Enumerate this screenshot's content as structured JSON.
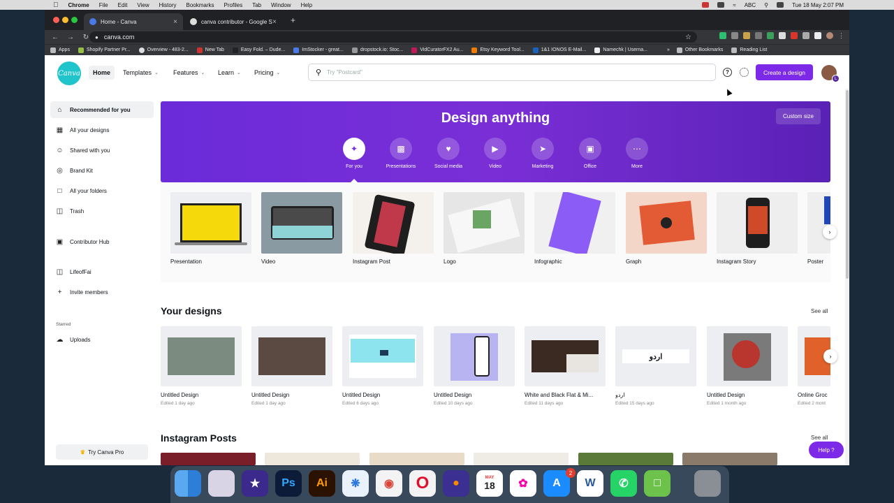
{
  "macbar": {
    "app": "Chrome",
    "menus": [
      "File",
      "Edit",
      "View",
      "History",
      "Bookmarks",
      "Profiles",
      "Tab",
      "Window",
      "Help"
    ],
    "input_source": "ABC",
    "clock": "Tue 18 May  2:07 PM"
  },
  "browser": {
    "tabs": [
      {
        "title": "Home - Canva",
        "active": true
      },
      {
        "title": "canva contributor - Google Se",
        "active": false
      }
    ],
    "url": "canva.com",
    "bookmarks": [
      "Apps",
      "Shopify Partner Pr...",
      "Overview - 483-2...",
      "New Tab",
      "Easy Fold. – Dude...",
      "ImStocker - great...",
      "dropstock.io: Stoc...",
      "VidCuratorFX2 Au...",
      "Etsy Keyword Tool...",
      "1&1 IONOS E-Mail...",
      "Namechk | Userna..."
    ],
    "other_bookmarks": "Other Bookmarks",
    "reading_list": "Reading List"
  },
  "header": {
    "logo": "Canva",
    "nav": [
      "Home",
      "Templates",
      "Features",
      "Learn",
      "Pricing"
    ],
    "search_placeholder": "Try \"Postcard\"",
    "create_button": "Create a design",
    "avatar_badge": "L"
  },
  "sidebar": {
    "items": [
      {
        "label": "Recommended for you",
        "icon": "home-icon"
      },
      {
        "label": "All your designs",
        "icon": "grid-icon"
      },
      {
        "label": "Shared with you",
        "icon": "people-icon"
      },
      {
        "label": "Brand Kit",
        "icon": "brand-icon"
      },
      {
        "label": "All your folders",
        "icon": "folder-icon"
      },
      {
        "label": "Trash",
        "icon": "trash-icon"
      },
      {
        "label": "Contributor Hub",
        "icon": "image-icon"
      },
      {
        "label": "LifeofFai",
        "icon": "team-icon"
      },
      {
        "label": "Invite members",
        "icon": "plus-icon"
      }
    ],
    "starred_label": "Starred",
    "uploads": "Uploads",
    "try_pro": "Try Canva Pro"
  },
  "hero": {
    "title": "Design anything",
    "custom_size": "Custom size",
    "categories": [
      "For you",
      "Presentations",
      "Social media",
      "Video",
      "Marketing",
      "Office",
      "More"
    ]
  },
  "templates": [
    "Presentation",
    "Video",
    "Instagram Post",
    "Logo",
    "Infographic",
    "Graph",
    "Instagram Story",
    "Poster"
  ],
  "your_designs": {
    "title": "Your designs",
    "see_all": "See all",
    "items": [
      {
        "title": "Untitled Design",
        "edited": "Edited 1 day ago"
      },
      {
        "title": "Untitled Design",
        "edited": "Edited 1 day ago"
      },
      {
        "title": "Untitled Design",
        "edited": "Edited 6 days ago"
      },
      {
        "title": "Untitled Design",
        "edited": "Edited 10 days ago"
      },
      {
        "title": "White and Black Flat & Mi...",
        "edited": "Edited 11 days ago"
      },
      {
        "title": "اردو",
        "edited": "Edited 15 days ago"
      },
      {
        "title": "Untitled Design",
        "edited": "Edited 1 month ago"
      },
      {
        "title": "Online Groc",
        "edited": "Edited 2 mont"
      }
    ]
  },
  "instagram_posts": {
    "title": "Instagram Posts",
    "see_all": "See all"
  },
  "help_button": "Help ?",
  "dock": {
    "calendar_month": "MAY",
    "calendar_day": "18",
    "appstore_badge": "2"
  }
}
